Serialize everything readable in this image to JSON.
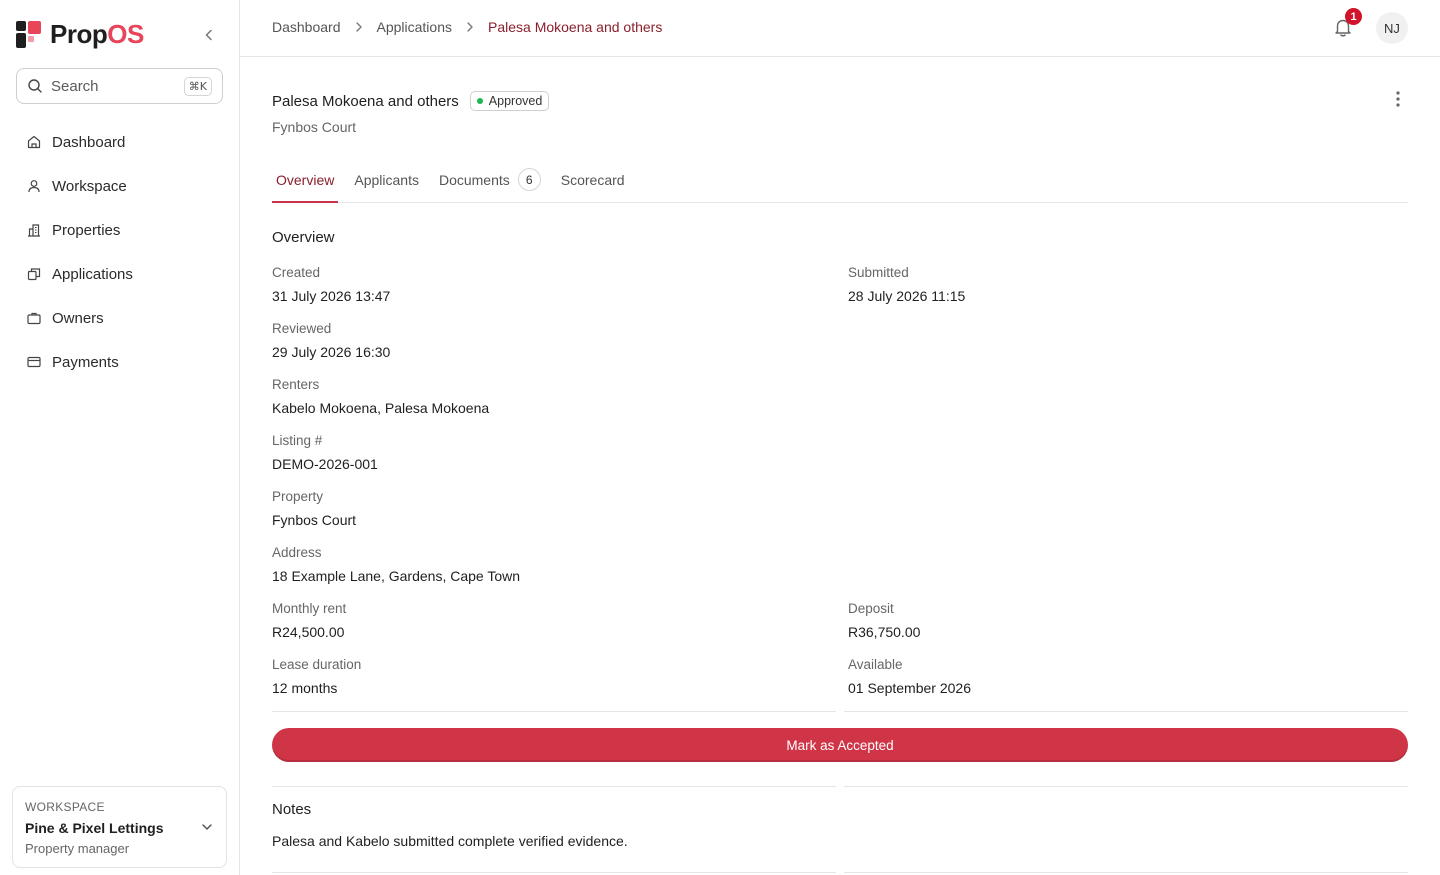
{
  "brand": {
    "name_prefix": "Prop",
    "name_accent": "OS"
  },
  "search": {
    "placeholder": "Search",
    "shortcut": "⌘K"
  },
  "sidebar": {
    "items": [
      {
        "label": "Dashboard",
        "icon": "home-icon"
      },
      {
        "label": "Workspace",
        "icon": "user-icon"
      },
      {
        "label": "Properties",
        "icon": "building-icon"
      },
      {
        "label": "Applications",
        "icon": "applications-icon"
      },
      {
        "label": "Owners",
        "icon": "briefcase-icon"
      },
      {
        "label": "Payments",
        "icon": "credit-card-icon"
      }
    ],
    "workspace": {
      "label": "WORKSPACE",
      "name": "Pine & Pixel Lettings",
      "role": "Property manager"
    }
  },
  "breadcrumb": {
    "items": [
      "Dashboard",
      "Applications"
    ],
    "current": "Palesa Mokoena and others"
  },
  "topbar": {
    "notifications_count": "1",
    "avatar_initials": "NJ"
  },
  "application": {
    "title": "Palesa Mokoena and others",
    "status": "Approved",
    "subtitle": "Fynbos Court"
  },
  "tabs": [
    {
      "label": "Overview",
      "active": true
    },
    {
      "label": "Applicants"
    },
    {
      "label": "Documents",
      "count": "6"
    },
    {
      "label": "Scorecard"
    }
  ],
  "overview": {
    "title": "Overview",
    "created": {
      "label": "Created",
      "value": "31 July 2026 13:47"
    },
    "submitted": {
      "label": "Submitted",
      "value": "28 July 2026 11:15"
    },
    "reviewed": {
      "label": "Reviewed",
      "value": "29 July 2026 16:30"
    },
    "renters": {
      "label": "Renters",
      "value": "Kabelo Mokoena, Palesa Mokoena"
    },
    "listing": {
      "label": "Listing #",
      "value": "DEMO-2026-001"
    },
    "property": {
      "label": "Property",
      "value": "Fynbos Court"
    },
    "address": {
      "label": "Address",
      "value": "18 Example Lane, Gardens, Cape Town"
    },
    "monthly_rent": {
      "label": "Monthly rent",
      "value": "R24,500.00"
    },
    "deposit": {
      "label": "Deposit",
      "value": "R36,750.00"
    },
    "lease_duration": {
      "label": "Lease duration",
      "value": "12 months"
    },
    "available": {
      "label": "Available",
      "value": "01 September 2026"
    }
  },
  "actions": {
    "accept_label": "Mark as Accepted"
  },
  "notes": {
    "title": "Notes",
    "text": "Palesa and Kabelo submitted complete verified evidence."
  },
  "colors": {
    "accent": "#cf3447",
    "active_text": "#8a1f2c",
    "status_dot": "#1fb84f",
    "badge": "#d0142c"
  }
}
